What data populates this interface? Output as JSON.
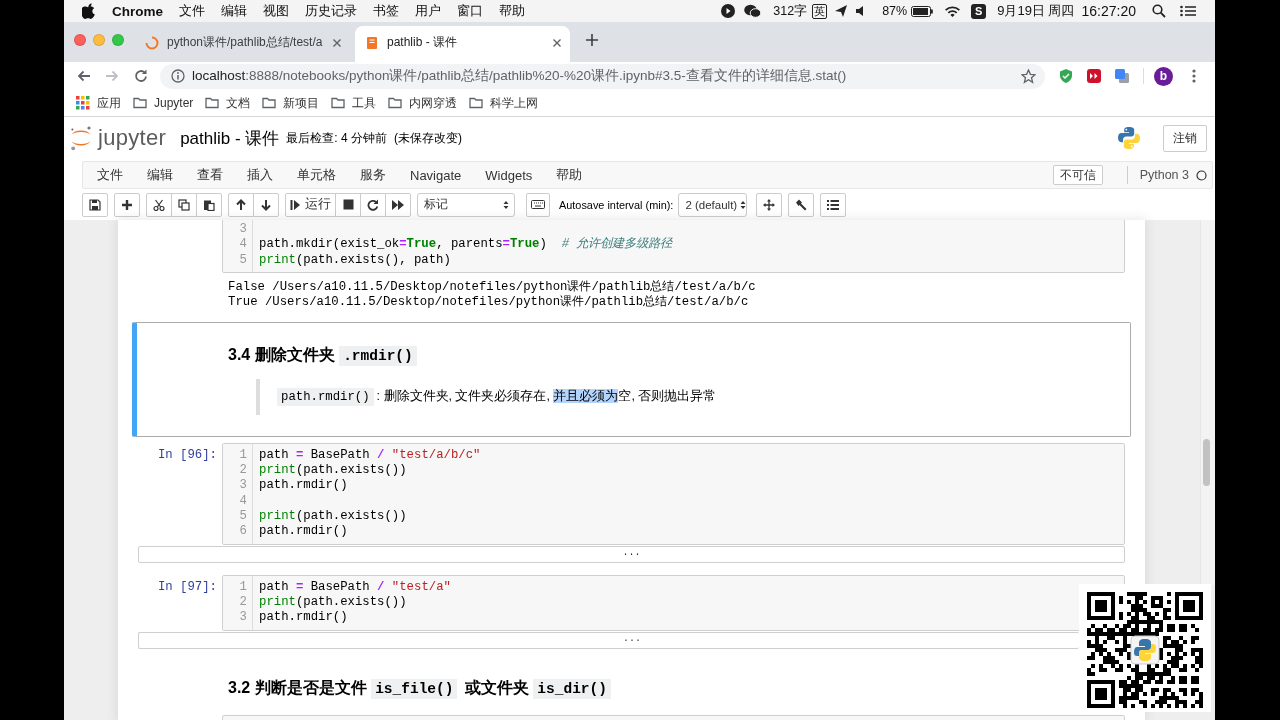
{
  "menu_bar": {
    "app": "Chrome",
    "menus": [
      "文件",
      "编辑",
      "视图",
      "历史记录",
      "书签",
      "用户",
      "窗口",
      "帮助"
    ],
    "word_count": "312字",
    "input_method": "英",
    "battery": "87%",
    "tray_badge": "S",
    "date": "9月19日 周四",
    "time": "16:27:20"
  },
  "browser": {
    "tabs": [
      {
        "title": "python课件/pathlib总结/test/a",
        "selected": false,
        "loading": true
      },
      {
        "title": "pathlib - 课件",
        "selected": true,
        "loading": false
      }
    ],
    "address": {
      "host": "localhost",
      "path": ":8888/notebooks/python课件/pathlib总结/pathlib%20-%20课件.ipynb#3.5-查看文件的详细信息.stat()"
    },
    "profile": "b",
    "bookmarks": [
      {
        "kind": "apps",
        "label": "应用"
      },
      {
        "kind": "folder",
        "label": "Jupyter"
      },
      {
        "kind": "folder",
        "label": "文档"
      },
      {
        "kind": "folder",
        "label": "新项目"
      },
      {
        "kind": "folder",
        "label": "工具"
      },
      {
        "kind": "folder",
        "label": "内网穿透"
      },
      {
        "kind": "folder",
        "label": "科学上网"
      }
    ]
  },
  "jupyter": {
    "logo": "jupyter",
    "notebook_name": "pathlib - 课件",
    "checkpoint": "最后检查: 4 分钟前",
    "save_status": "(未保存改变)",
    "logout": "注销",
    "menus": [
      "文件",
      "编辑",
      "查看",
      "插入",
      "单元格",
      "服务",
      "Navigate",
      "Widgets",
      "帮助"
    ],
    "trust": "不可信",
    "kernel": "Python 3",
    "kernel_busy": false,
    "toolbar": {
      "run_label": "运行",
      "cell_type": "标记",
      "autosave_label": "Autosave interval (min):",
      "autosave_value": "2 (default)"
    }
  },
  "cells": [
    {
      "kind": "code",
      "selected": false,
      "lines": [
        {
          "number": "3"
        },
        {
          "number": "4",
          "tokens": [
            {
              "text": "path.mkdir(exist_ok",
              "kind": "name"
            },
            {
              "text": "=",
              "kind": "operator"
            },
            {
              "text": "True",
              "kind": "keyword"
            },
            {
              "text": ", parents",
              "kind": "name"
            },
            {
              "text": "=",
              "kind": "operator"
            },
            {
              "text": "True",
              "kind": "keyword"
            },
            {
              "text": ")  ",
              "kind": "name"
            },
            {
              "text": "# 允许创建多级路径",
              "kind": "comment"
            }
          ]
        },
        {
          "number": "5",
          "tokens": [
            {
              "text": "print",
              "kind": "builtin"
            },
            {
              "text": "(path.exists(), path)",
              "kind": "name"
            }
          ]
        }
      ],
      "output": {
        "kind": "text",
        "lines": [
          "False /Users/a10.11.5/Desktop/notefiles/python课件/pathlib总结/test/a/b/c",
          "True /Users/a10.11.5/Desktop/notefiles/python课件/pathlib总结/test/a/b/c"
        ]
      }
    },
    {
      "kind": "markdown",
      "selected": true,
      "blocks": [
        {
          "kind": "heading",
          "parts": [
            {
              "kind": "text",
              "text": "3.4 删除文件夹 "
            },
            {
              "kind": "code",
              "text": ".rmdir()"
            }
          ]
        },
        {
          "kind": "quote",
          "parts": [
            {
              "kind": "code",
              "text": "path.rmdir()"
            },
            {
              "kind": "text",
              "text": ": 删除文件夹, 文件夹必须存在, "
            },
            {
              "kind": "selection",
              "text": "并且必须为"
            },
            {
              "kind": "text",
              "text": "空, 否则抛出异常"
            }
          ]
        }
      ]
    },
    {
      "kind": "code",
      "selected": false,
      "prompt": "In [96]:",
      "lines": [
        {
          "number": "1",
          "tokens": [
            {
              "text": "path ",
              "kind": "name"
            },
            {
              "text": "=",
              "kind": "operator"
            },
            {
              "text": " BasePath ",
              "kind": "name"
            },
            {
              "text": "/",
              "kind": "operator"
            },
            {
              "text": " \"test/a/b/c\"",
              "kind": "string"
            }
          ]
        },
        {
          "number": "2",
          "tokens": [
            {
              "text": "print",
              "kind": "builtin"
            },
            {
              "text": "(path.exists())",
              "kind": "name"
            }
          ]
        },
        {
          "number": "3",
          "tokens": [
            {
              "text": "path.rmdir()",
              "kind": "name"
            }
          ]
        },
        {
          "number": "4"
        },
        {
          "number": "5",
          "tokens": [
            {
              "text": "print",
              "kind": "builtin"
            },
            {
              "text": "(path.exists())",
              "kind": "name"
            }
          ]
        },
        {
          "number": "6",
          "tokens": [
            {
              "text": "path.rmdir()",
              "kind": "name"
            }
          ]
        }
      ],
      "output": {
        "kind": "collapsed",
        "label": "..."
      }
    },
    {
      "kind": "code",
      "selected": false,
      "prompt": "In [97]:",
      "lines": [
        {
          "number": "1",
          "tokens": [
            {
              "text": "path ",
              "kind": "name"
            },
            {
              "text": "=",
              "kind": "operator"
            },
            {
              "text": " BasePath ",
              "kind": "name"
            },
            {
              "text": "/",
              "kind": "operator"
            },
            {
              "text": " \"test/a\"",
              "kind": "string"
            }
          ]
        },
        {
          "number": "2",
          "tokens": [
            {
              "text": "print",
              "kind": "builtin"
            },
            {
              "text": "(path.exists())",
              "kind": "name"
            }
          ]
        },
        {
          "number": "3",
          "tokens": [
            {
              "text": "path.rmdir()",
              "kind": "name"
            }
          ]
        }
      ],
      "output": {
        "kind": "collapsed",
        "label": "..."
      }
    },
    {
      "kind": "markdown",
      "selected": false,
      "blocks": [
        {
          "kind": "heading",
          "parts": [
            {
              "kind": "text",
              "text": "3.2 判断是否是文件 "
            },
            {
              "kind": "code",
              "text": "is_file()"
            },
            {
              "kind": "text",
              "text": " 或文件夹 "
            },
            {
              "kind": "code",
              "text": "is_dir()"
            }
          ]
        }
      ]
    },
    {
      "kind": "code",
      "selected": false
    }
  ]
}
